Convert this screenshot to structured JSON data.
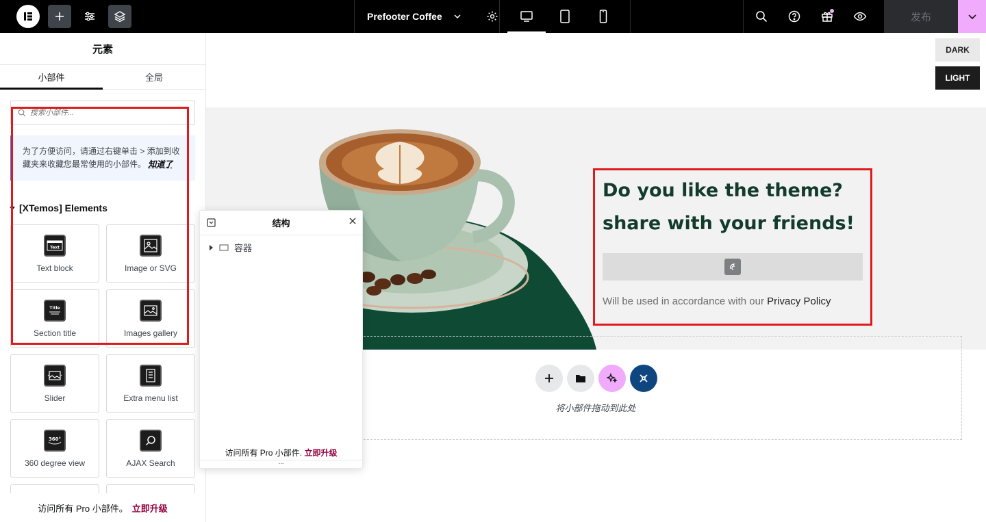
{
  "topbar": {
    "page_name": "Prefooter Coffee",
    "publish_label": "发布"
  },
  "panel": {
    "title": "元素",
    "tabs": [
      {
        "label": "小部件",
        "active": true
      },
      {
        "label": "全局",
        "active": false
      }
    ],
    "search_placeholder": "搜索小部件...",
    "notice_text": "为了方便访问，请通过右键单击 > 添加到收藏夹来收藏您最常使用的小部件。",
    "notice_link": "知道了",
    "section_title": "[XTemos] Elements",
    "widgets": [
      {
        "label": "Text block",
        "icon": "text-block-icon"
      },
      {
        "label": "Image or SVG",
        "icon": "image-svg-icon"
      },
      {
        "label": "Section title",
        "icon": "section-title-icon"
      },
      {
        "label": "Images gallery",
        "icon": "images-gallery-icon"
      },
      {
        "label": "Slider",
        "icon": "slider-icon"
      },
      {
        "label": "Extra menu list",
        "icon": "extra-menu-list-icon"
      },
      {
        "label": "360 degree view",
        "icon": "360-view-icon"
      },
      {
        "label": "AJAX Search",
        "icon": "ajax-search-icon"
      }
    ],
    "footer_text": "访问所有 Pro 小部件。",
    "footer_link": "立即升级"
  },
  "canvas": {
    "mode_dark": "DARK",
    "mode_light": "LIGHT",
    "cta_title": "Do you like the theme? share with your friends!",
    "policy_prefix": "Will be used in accordance with our",
    "policy_link": "Privacy Policy",
    "drop_text": "将小部件拖动到此处"
  },
  "structure": {
    "title": "结构",
    "item": "容器",
    "footer_text": "访问所有 Pro 小部件.",
    "footer_link": "立即升级",
    "dots": "..."
  },
  "colors": {
    "accent_pink": "#f0abfc",
    "upgrade_link": "#93003f",
    "dark_green": "#123b2c",
    "highlight_red": "#e0191b",
    "brand_blue": "#10467f"
  }
}
